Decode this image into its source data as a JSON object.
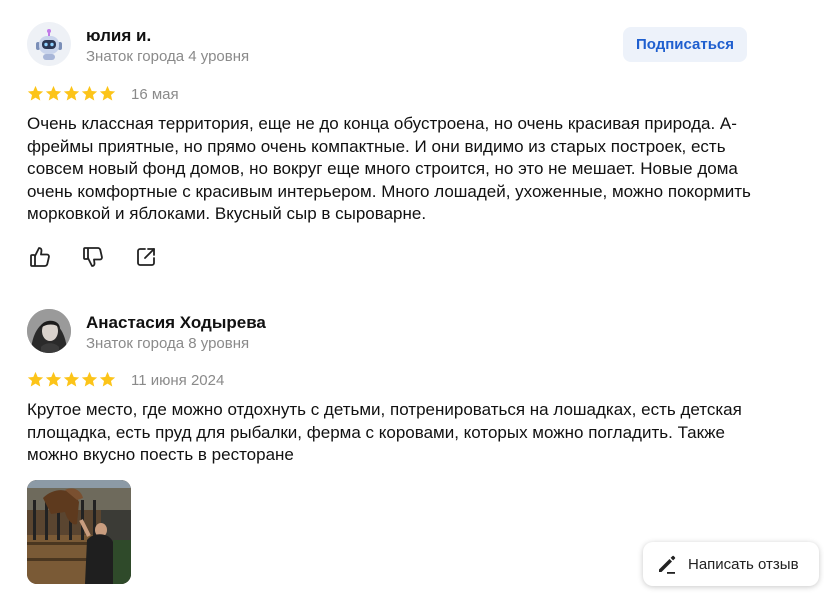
{
  "reviews": [
    {
      "author": "юлия и.",
      "level": "Знаток города 4 уровня",
      "subscribe_label": "Подписаться",
      "rating": 5,
      "date": "16 мая",
      "text": "Очень классная территория, еще не до конца обустроена, но очень красивая природа. А-фреймы приятные, но прямо очень компактные. И они видимо из старых построек, есть совсем новый фонд домов, но вокруг еще много строится, но это не мешает. Новые дома очень комфортные с красивым интерьером. Много лошадей, ухоженные, можно покормить морковкой и яблоками. Вкусный сыр в сыроварне.",
      "actions": [
        "like-icon",
        "dislike-icon",
        "share-icon"
      ]
    },
    {
      "author": "Анастасия Ходырева",
      "level": "Знаток города 8 уровня",
      "rating": 5,
      "date": "11 июня 2024",
      "text": "Крутое место, где можно отдохнуть с детьми, потренироваться на лошадках, есть детская площадка, есть пруд для рыбалки, ферма с коровами, которых можно погладить. Также можно вкусно поесть в ресторане"
    }
  ],
  "write_review": {
    "label": "Написать отзыв",
    "icon": "pencil-icon"
  },
  "colors": {
    "star": "#fcc419",
    "accent": "#1f5fcf",
    "muted": "#8a8a8a",
    "button_bg": "#edf2fa"
  }
}
